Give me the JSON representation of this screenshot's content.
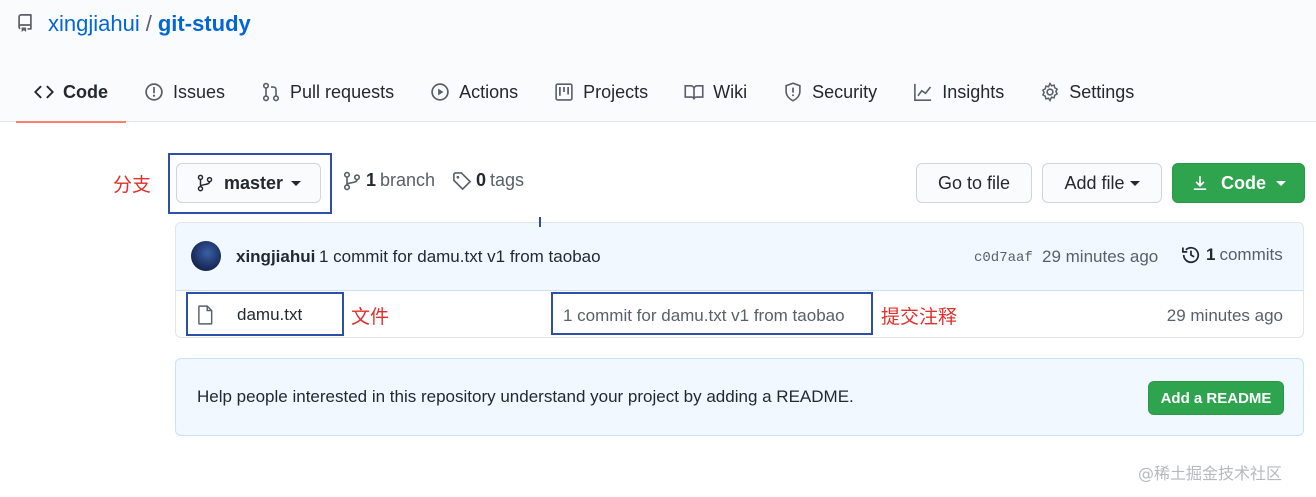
{
  "repo": {
    "owner": "xingjiahui",
    "separator": "/",
    "name": "git-study"
  },
  "tabs": [
    {
      "label": "Code",
      "icon": "code-icon",
      "active": true
    },
    {
      "label": "Issues",
      "icon": "issue-icon"
    },
    {
      "label": "Pull requests",
      "icon": "pull-request-icon"
    },
    {
      "label": "Actions",
      "icon": "play-icon"
    },
    {
      "label": "Projects",
      "icon": "project-icon"
    },
    {
      "label": "Wiki",
      "icon": "book-icon"
    },
    {
      "label": "Security",
      "icon": "shield-icon"
    },
    {
      "label": "Insights",
      "icon": "graph-icon"
    },
    {
      "label": "Settings",
      "icon": "gear-icon"
    }
  ],
  "toolbar": {
    "branch_select": "master",
    "branch_count": "1",
    "branch_label": "branch",
    "tag_count": "0",
    "tag_label": "tags",
    "go_to_file": "Go to file",
    "add_file": "Add file",
    "code_button": "Code"
  },
  "latest_commit": {
    "author": "xingjiahui",
    "message": "1 commit for damu.txt v1 from taobao",
    "sha": "c0d7aaf",
    "time": "29 minutes ago",
    "commit_count": "1",
    "commit_label": "commits"
  },
  "files": [
    {
      "name": "damu.txt",
      "message": "1 commit for damu.txt v1 from taobao",
      "time": "29 minutes ago"
    }
  ],
  "readme": {
    "text": "Help people interested in this repository understand your project by adding a README.",
    "button": "Add a README"
  },
  "annotations": {
    "branch": "分支",
    "file": "文件",
    "commit_note": "提交注释"
  },
  "watermark": "@稀土掘金技术社区",
  "colors": {
    "link": "#0366d6",
    "primary_button": "#2ea44f",
    "tab_underline": "#f9826c",
    "annotation_box": "#2e4fa8",
    "annotation_text": "#e0302a"
  }
}
